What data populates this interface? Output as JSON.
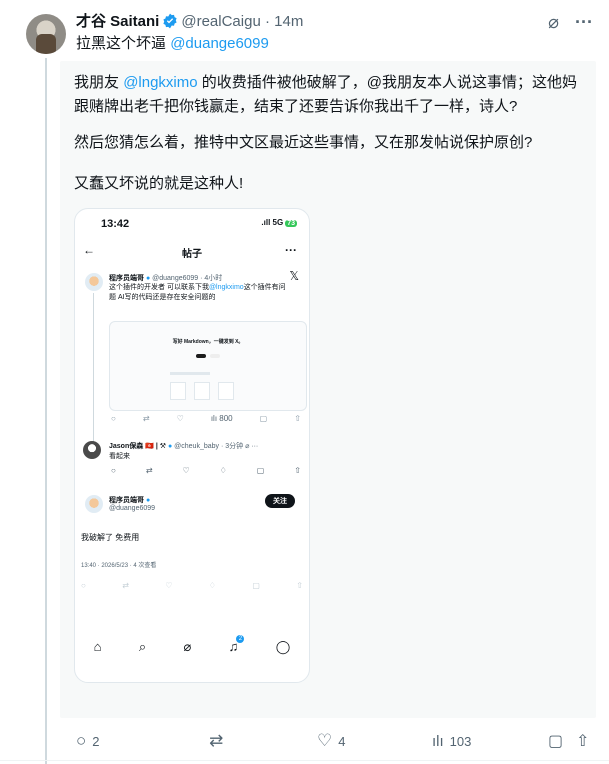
{
  "post": {
    "author_name": "才谷 Saitani",
    "author_handle": "@realCaigu",
    "separator": "·",
    "time": "14m",
    "reply_prefix": "拉黑这个坏逼",
    "reply_mention": "@duange6099",
    "para1_a": "我朋友",
    "para1_mention": "@lngkximo",
    "para1_b": "的收费插件被他破解了，@我朋友本人说这事情；这他妈跟赌牌出老千把你钱赢走，结束了还要告诉你我出千了一样，诗人?",
    "para2": "然后您猜怎么着，推特中文区最近这些事情，又在那发帖说保护原创?",
    "para3": "又蠢又坏说的就是这种人!",
    "replies": "2",
    "likes": "4",
    "views": "103"
  },
  "phone": {
    "status_time": "13:42",
    "signal": ".ıll 5G",
    "battery": "73",
    "header_title": "帖子",
    "tweet1": {
      "name": "程序员端哥",
      "handle": "@duange6099",
      "time": "· 4小时",
      "text_a": "这个插件的开发者 可以联系下我",
      "text_mention": "@lngkximo",
      "text_b": "这个插件有问",
      "text_c": "题 AI写的代码还是存在安全问题的",
      "card_title": "写好 Markdown，一键发到 X。",
      "views": "800"
    },
    "tweet2": {
      "name": "Jason保森 🇭🇰 | ⚒",
      "handle": "@cheuk_baby · 3分钟",
      "text": "看起来"
    },
    "tweet3": {
      "name": "程序员端哥",
      "handle": "@duange6099",
      "follow": "关注",
      "text": "我破解了 免费用",
      "meta": "13:40 · 2026/5/23 · 4 次查看"
    },
    "nav_badge": "2"
  }
}
